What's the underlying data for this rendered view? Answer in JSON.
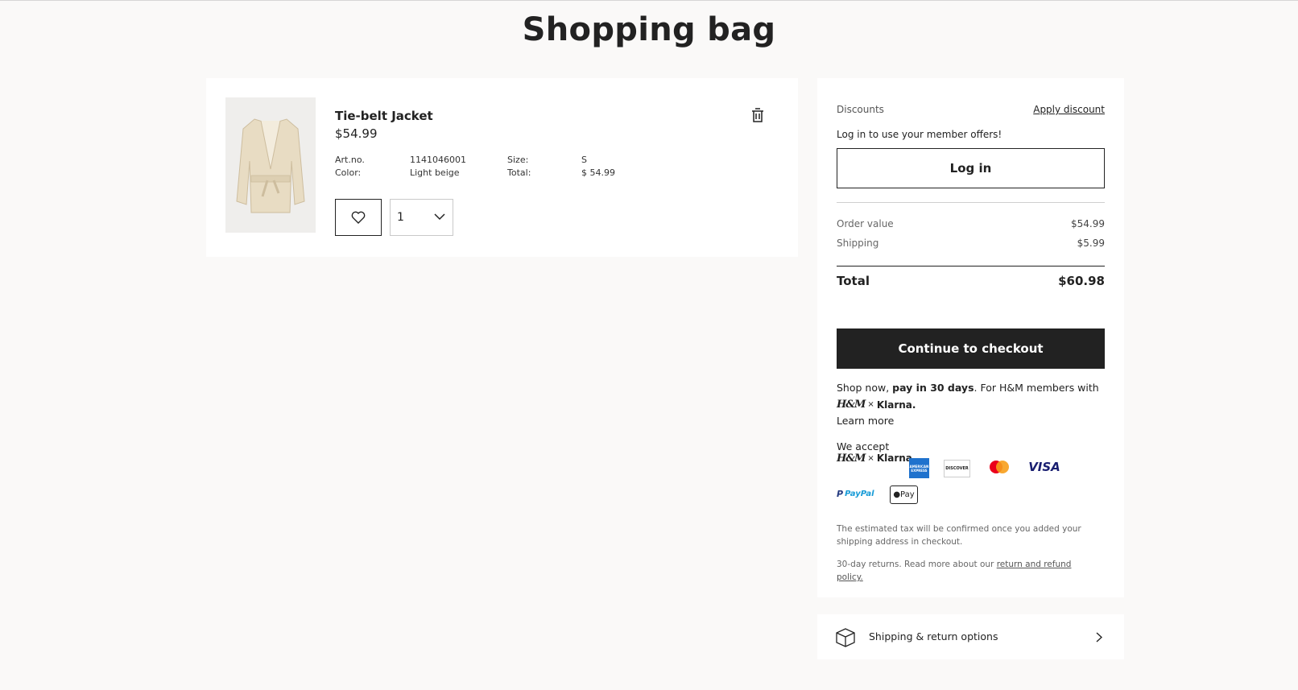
{
  "page": {
    "title": "Shopping bag"
  },
  "item": {
    "name": "Tie-belt Jacket",
    "price": "$54.99",
    "artno_label": "Art.no.",
    "artno": "1141046001",
    "color_label": "Color:",
    "color": "Light beige",
    "size_label": "Size:",
    "size": "S",
    "total_label": "Total:",
    "total": "$ 54.99",
    "quantity": "1",
    "image_color": "#e8dcc3"
  },
  "summary": {
    "discounts_label": "Discounts",
    "apply_discount": "Apply discount",
    "login_offer": "Log in to use your member offers!",
    "login_button": "Log in",
    "order_value_label": "Order value",
    "order_value": "$54.99",
    "shipping_label": "Shipping",
    "shipping": "$5.99",
    "total_label": "Total",
    "total": "$60.98",
    "checkout_button": "Continue to checkout",
    "paylater_prefix": "Shop now, ",
    "paylater_bold": "pay in 30 days",
    "paylater_suffix": ". For H&M members with",
    "hm_logo": "H&M",
    "times": "×",
    "klarna": "Klarna.",
    "learn_more": "Learn more",
    "we_accept": "We accept",
    "payment_methods": [
      "H&M × Klarna",
      "American Express",
      "Discover",
      "Mastercard",
      "VISA",
      "PayPal",
      "Apple Pay"
    ],
    "amex_text": "AMERICAN EXPRESS",
    "discover_text": "DISCOVER",
    "visa_text": "VISA",
    "paypal_text": "PayPal",
    "applepay_text": "Pay",
    "tax_note": "The estimated tax will be confirmed once you added your shipping address in checkout.",
    "returns_prefix": "30-day returns. Read more about our ",
    "returns_link": "return and refund policy."
  },
  "shipping_options": {
    "label": "Shipping & return options"
  },
  "colors": {
    "background": "#faf9f8",
    "primary": "#222222",
    "card": "#ffffff",
    "amex": "#1f72cd",
    "mastercard_red": "#eb001b",
    "mastercard_orange": "#f79e1b",
    "visa": "#1a1f71",
    "discover_orange": "#f47216"
  }
}
